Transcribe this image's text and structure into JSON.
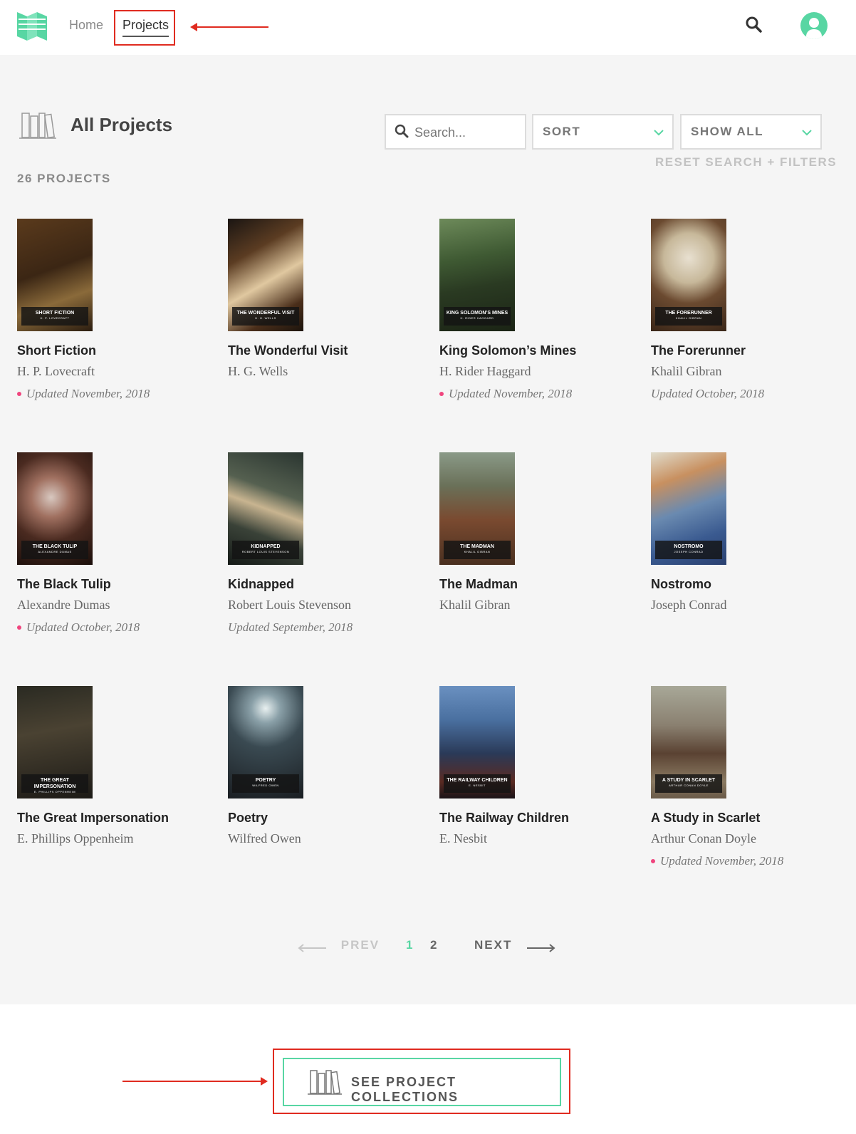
{
  "header": {
    "nav": {
      "home": "Home",
      "projects": "Projects"
    }
  },
  "colors": {
    "accent": "#58d6a3",
    "annotation": "#e02b20",
    "updated_dot": "#f0457e"
  },
  "page": {
    "title": "All Projects",
    "search_placeholder": "Search...",
    "sort_label": "SORT",
    "filter_label": "SHOW ALL",
    "reset_label": "RESET SEARCH + FILTERS",
    "count": "26 PROJECTS"
  },
  "projects": [
    {
      "title": "Short Fiction",
      "author": "H. P. Lovecraft",
      "updated": "Updated November, 2018",
      "cover_title": "SHORT FICTION",
      "cover_author": "H. P. LOVECRAFT"
    },
    {
      "title": "The Wonderful Visit",
      "author": "H. G. Wells",
      "updated": "",
      "cover_title": "THE WONDERFUL VISIT",
      "cover_author": "H. G. WELLS"
    },
    {
      "title": "King Solomon’s Mines",
      "author": "H. Rider Haggard",
      "updated": "Updated November, 2018",
      "cover_title": "KING SOLOMON’S MINES",
      "cover_author": "H. RIDER HAGGARD"
    },
    {
      "title": "The Forerunner",
      "author": "Khalil Gibran",
      "updated": "Updated October, 2018",
      "cover_title": "THE FORERUNNER",
      "cover_author": "KHALIL GIBRAN"
    },
    {
      "title": "The Black Tulip",
      "author": "Alexandre Dumas",
      "updated": "Updated October, 2018",
      "cover_title": "THE BLACK TULIP",
      "cover_author": "ALEXANDRE DUMAS"
    },
    {
      "title": "Kidnapped",
      "author": "Robert Louis Stevenson",
      "updated": "Updated September, 2018",
      "cover_title": "KIDNAPPED",
      "cover_author": "ROBERT LOUIS STEVENSON"
    },
    {
      "title": "The Madman",
      "author": "Khalil Gibran",
      "updated": "",
      "cover_title": "THE MADMAN",
      "cover_author": "KHALIL GIBRAN"
    },
    {
      "title": "Nostromo",
      "author": "Joseph Conrad",
      "updated": "",
      "cover_title": "NOSTROMO",
      "cover_author": "JOSEPH CONRAD"
    },
    {
      "title": "The Great Impersonation",
      "author": "E. Phillips Oppenheim",
      "updated": "",
      "cover_title": "THE GREAT IMPERSONATION",
      "cover_author": "E. PHILLIPS OPPENHEIM"
    },
    {
      "title": "Poetry",
      "author": "Wilfred Owen",
      "updated": "",
      "cover_title": "POETRY",
      "cover_author": "WILFRED OWEN"
    },
    {
      "title": "The Railway Children",
      "author": "E. Nesbit",
      "updated": "",
      "cover_title": "THE RAILWAY CHILDREN",
      "cover_author": "E. NESBIT"
    },
    {
      "title": "A Study in Scarlet",
      "author": "Arthur Conan Doyle",
      "updated": "Updated November, 2018",
      "cover_title": "A STUDY IN SCARLET",
      "cover_author": "ARTHUR CONAN DOYLE"
    }
  ],
  "pagination": {
    "prev": "PREV",
    "pages": [
      "1",
      "2"
    ],
    "current": "1",
    "next": "NEXT"
  },
  "footer": {
    "collections_label": "SEE PROJECT COLLECTIONS"
  }
}
